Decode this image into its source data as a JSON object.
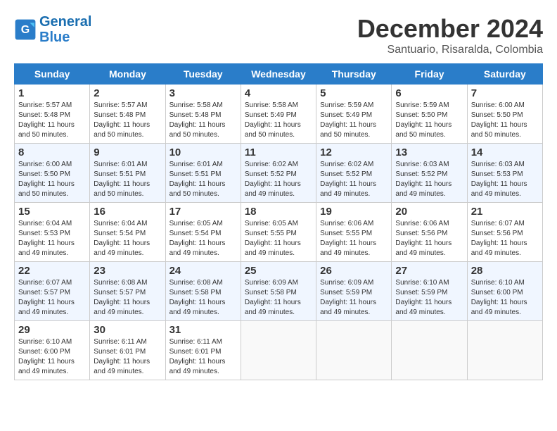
{
  "header": {
    "logo_line1": "General",
    "logo_line2": "Blue",
    "month_title": "December 2024",
    "subtitle": "Santuario, Risaralda, Colombia"
  },
  "weekdays": [
    "Sunday",
    "Monday",
    "Tuesday",
    "Wednesday",
    "Thursday",
    "Friday",
    "Saturday"
  ],
  "weeks": [
    [
      {
        "day": "1",
        "sunrise": "5:57 AM",
        "sunset": "5:48 PM",
        "daylight": "11 hours and 50 minutes."
      },
      {
        "day": "2",
        "sunrise": "5:57 AM",
        "sunset": "5:48 PM",
        "daylight": "11 hours and 50 minutes."
      },
      {
        "day": "3",
        "sunrise": "5:58 AM",
        "sunset": "5:48 PM",
        "daylight": "11 hours and 50 minutes."
      },
      {
        "day": "4",
        "sunrise": "5:58 AM",
        "sunset": "5:49 PM",
        "daylight": "11 hours and 50 minutes."
      },
      {
        "day": "5",
        "sunrise": "5:59 AM",
        "sunset": "5:49 PM",
        "daylight": "11 hours and 50 minutes."
      },
      {
        "day": "6",
        "sunrise": "5:59 AM",
        "sunset": "5:50 PM",
        "daylight": "11 hours and 50 minutes."
      },
      {
        "day": "7",
        "sunrise": "6:00 AM",
        "sunset": "5:50 PM",
        "daylight": "11 hours and 50 minutes."
      }
    ],
    [
      {
        "day": "8",
        "sunrise": "6:00 AM",
        "sunset": "5:50 PM",
        "daylight": "11 hours and 50 minutes."
      },
      {
        "day": "9",
        "sunrise": "6:01 AM",
        "sunset": "5:51 PM",
        "daylight": "11 hours and 50 minutes."
      },
      {
        "day": "10",
        "sunrise": "6:01 AM",
        "sunset": "5:51 PM",
        "daylight": "11 hours and 50 minutes."
      },
      {
        "day": "11",
        "sunrise": "6:02 AM",
        "sunset": "5:52 PM",
        "daylight": "11 hours and 49 minutes."
      },
      {
        "day": "12",
        "sunrise": "6:02 AM",
        "sunset": "5:52 PM",
        "daylight": "11 hours and 49 minutes."
      },
      {
        "day": "13",
        "sunrise": "6:03 AM",
        "sunset": "5:52 PM",
        "daylight": "11 hours and 49 minutes."
      },
      {
        "day": "14",
        "sunrise": "6:03 AM",
        "sunset": "5:53 PM",
        "daylight": "11 hours and 49 minutes."
      }
    ],
    [
      {
        "day": "15",
        "sunrise": "6:04 AM",
        "sunset": "5:53 PM",
        "daylight": "11 hours and 49 minutes."
      },
      {
        "day": "16",
        "sunrise": "6:04 AM",
        "sunset": "5:54 PM",
        "daylight": "11 hours and 49 minutes."
      },
      {
        "day": "17",
        "sunrise": "6:05 AM",
        "sunset": "5:54 PM",
        "daylight": "11 hours and 49 minutes."
      },
      {
        "day": "18",
        "sunrise": "6:05 AM",
        "sunset": "5:55 PM",
        "daylight": "11 hours and 49 minutes."
      },
      {
        "day": "19",
        "sunrise": "6:06 AM",
        "sunset": "5:55 PM",
        "daylight": "11 hours and 49 minutes."
      },
      {
        "day": "20",
        "sunrise": "6:06 AM",
        "sunset": "5:56 PM",
        "daylight": "11 hours and 49 minutes."
      },
      {
        "day": "21",
        "sunrise": "6:07 AM",
        "sunset": "5:56 PM",
        "daylight": "11 hours and 49 minutes."
      }
    ],
    [
      {
        "day": "22",
        "sunrise": "6:07 AM",
        "sunset": "5:57 PM",
        "daylight": "11 hours and 49 minutes."
      },
      {
        "day": "23",
        "sunrise": "6:08 AM",
        "sunset": "5:57 PM",
        "daylight": "11 hours and 49 minutes."
      },
      {
        "day": "24",
        "sunrise": "6:08 AM",
        "sunset": "5:58 PM",
        "daylight": "11 hours and 49 minutes."
      },
      {
        "day": "25",
        "sunrise": "6:09 AM",
        "sunset": "5:58 PM",
        "daylight": "11 hours and 49 minutes."
      },
      {
        "day": "26",
        "sunrise": "6:09 AM",
        "sunset": "5:59 PM",
        "daylight": "11 hours and 49 minutes."
      },
      {
        "day": "27",
        "sunrise": "6:10 AM",
        "sunset": "5:59 PM",
        "daylight": "11 hours and 49 minutes."
      },
      {
        "day": "28",
        "sunrise": "6:10 AM",
        "sunset": "6:00 PM",
        "daylight": "11 hours and 49 minutes."
      }
    ],
    [
      {
        "day": "29",
        "sunrise": "6:10 AM",
        "sunset": "6:00 PM",
        "daylight": "11 hours and 49 minutes."
      },
      {
        "day": "30",
        "sunrise": "6:11 AM",
        "sunset": "6:01 PM",
        "daylight": "11 hours and 49 minutes."
      },
      {
        "day": "31",
        "sunrise": "6:11 AM",
        "sunset": "6:01 PM",
        "daylight": "11 hours and 49 minutes."
      },
      null,
      null,
      null,
      null
    ]
  ]
}
